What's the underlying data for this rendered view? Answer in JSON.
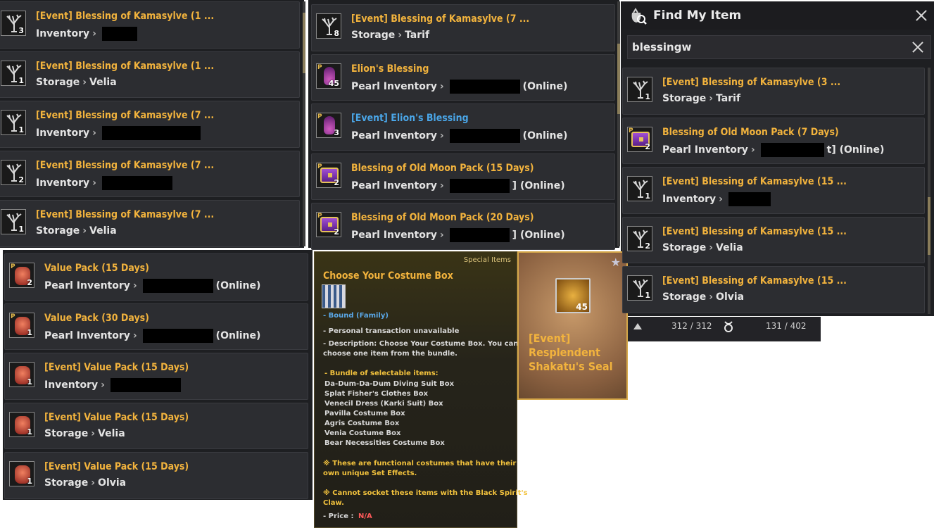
{
  "panel_left": {
    "rows": [
      {
        "name": "[Event] Blessing of Kamasylve (1 ...",
        "location": "Inventory",
        "qty": "3",
        "redacted": true,
        "suffix": ""
      },
      {
        "name": "[Event] Blessing of Kamasylve (1 ...",
        "location": "Storage",
        "place": "Velia",
        "qty": "1"
      },
      {
        "name": "[Event] Blessing of Kamasylve (7 ...",
        "location": "Inventory",
        "qty": "1",
        "redacted": true
      },
      {
        "name": "[Event] Blessing of Kamasylve (7 ...",
        "location": "Inventory",
        "qty": "2",
        "redacted": true
      },
      {
        "name": "[Event] Blessing of Kamasylve (7 ...",
        "location": "Storage",
        "place": "Velia",
        "qty": "1"
      }
    ]
  },
  "panel_mid": {
    "rows": [
      {
        "name": "[Event] Blessing of Kamasylve (7 ...",
        "location": "Storage",
        "place": "Tarif",
        "qty": "8"
      },
      {
        "name": "Elion's Blessing",
        "location": "Pearl Inventory",
        "suffix": "(Online)",
        "qty": "45"
      },
      {
        "name": "[Event] Elion's Blessing",
        "location": "Pearl Inventory",
        "suffix": "(Online)",
        "qty": "3"
      },
      {
        "name": "Blessing of Old Moon Pack (15 Days)",
        "location": "Pearl Inventory",
        "suffix": "] (Online)",
        "qty": "2"
      },
      {
        "name": "Blessing of Old Moon Pack (20 Days)",
        "location": "Pearl Inventory",
        "suffix": "] (Online)",
        "qty": "2"
      }
    ]
  },
  "panel_lower": {
    "rows": [
      {
        "name": "Value Pack (15 Days)",
        "location": "Pearl Inventory",
        "suffix": "(Online)",
        "qty": "2"
      },
      {
        "name": "Value Pack (30 Days)",
        "location": "Pearl Inventory",
        "suffix": "(Online)",
        "qty": "1"
      },
      {
        "name": "[Event] Value Pack (15 Days)",
        "location": "Inventory",
        "qty": "1"
      },
      {
        "name": "[Event] Value Pack (15 Days)",
        "location": "Storage",
        "place": "Velia",
        "qty": "1"
      },
      {
        "name": "[Event] Value Pack (15 Days)",
        "location": "Storage",
        "place": "Olvia",
        "qty": "1"
      }
    ]
  },
  "find": {
    "title": "Find My Item",
    "search_value": "blessingw",
    "rows": [
      {
        "name": "[Event] Blessing of Kamasylve (3 ...",
        "location": "Storage",
        "place": "Tarif",
        "qty": "1"
      },
      {
        "name": "Blessing of Old Moon Pack (7 Days)",
        "location": "Pearl Inventory",
        "suffix": "t] (Online)",
        "qty": "2"
      },
      {
        "name": "[Event] Blessing of Kamasylve (15 ...",
        "location": "Inventory",
        "qty": "1"
      },
      {
        "name": "[Event] Blessing of Kamasylve (15 ...",
        "location": "Storage",
        "place": "Velia",
        "qty": "2"
      },
      {
        "name": "[Event] Blessing of Kamasylve (15 ...",
        "location": "Storage",
        "place": "Olvia",
        "qty": "1"
      }
    ],
    "weight": "312 / 312",
    "slots": "131 / 402"
  },
  "tooltip": {
    "category": "Special Items",
    "title": "Choose Your Costume Box",
    "bound": "- Bound (Family)",
    "line1": "- Personal transaction unavailable",
    "desc1": "- Description: Choose Your Costume Box. You can",
    "desc2": "choose one item from the bundle.",
    "bundle_header": "- Bundle of selectable items:",
    "items": [
      "Da-Dum-Da-Dum Diving Suit Box",
      "Splat Fisher's Clothes Box",
      "Venecil Dress (Karki Suit) Box",
      "Pavilla Costume Box",
      "Agris Costume Box",
      "Venia Costume Box",
      "Bear Necessities Costume Box"
    ],
    "note1a": "※ These are functional costumes that have their",
    "note1b": "own unique Set Effects.",
    "note2a": "※ Cannot socket these items with the Black Spirit's",
    "note2b": "Claw.",
    "price_label": "- Price :",
    "price_value": "N/A"
  },
  "seal": {
    "name": "[Event] Resplendent Shakatu's Seal",
    "qty": "45"
  }
}
